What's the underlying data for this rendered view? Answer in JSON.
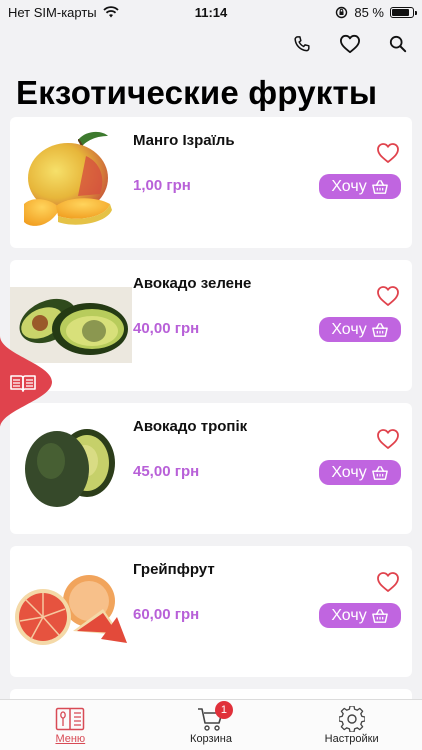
{
  "status": {
    "carrier": "Нет SIM-карты",
    "time": "11:14",
    "battery": "85 %"
  },
  "header": {
    "title": "Екзотические фрукты"
  },
  "products": [
    {
      "name": "Манго Ізраїль",
      "price": "1,00 грн",
      "button": "Хочу"
    },
    {
      "name": "Авокадо зелене",
      "price": "40,00 грн",
      "button": "Хочу"
    },
    {
      "name": "Авокадо тропік",
      "price": "45,00 грн",
      "button": "Хочу"
    },
    {
      "name": "Грейпфрут",
      "price": "60,00 грн",
      "button": "Хочу"
    }
  ],
  "tabbar": {
    "menu": "Меню",
    "cart": "Корзина",
    "cart_badge": "1",
    "settings": "Настройки"
  },
  "colors": {
    "accent": "#c065e0",
    "price": "#b860d8",
    "brand_red": "#e0434d"
  }
}
